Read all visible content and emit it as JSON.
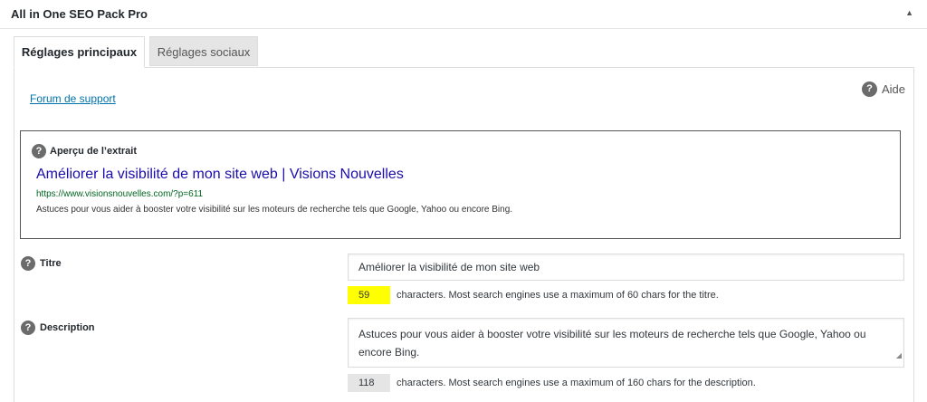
{
  "panel": {
    "title": "All in One SEO Pack Pro",
    "toggle_icon": "triangle-up-icon",
    "toggle_glyph": "▲"
  },
  "tabs": [
    {
      "label": "Réglages principaux",
      "active": true
    },
    {
      "label": "Réglages sociaux",
      "active": false
    }
  ],
  "support_link": "Forum de support",
  "help": {
    "label": "Aide",
    "icon": "question-icon",
    "glyph": "?"
  },
  "snippet": {
    "heading": "Aperçu de l’extrait",
    "title": "Améliorer la visibilité de mon site web | Visions Nouvelles",
    "url": "https://www.visionsnouvelles.com/?p=611",
    "description": "Astuces pour vous aider à booster votre visibilité sur les moteurs de recherche tels que Google, Yahoo ou encore Bing."
  },
  "fields": {
    "title": {
      "label": "Titre",
      "value": "Améliorer la visibilité de mon site web",
      "count": "59",
      "note": "characters. Most search engines use a maximum of 60 chars for the titre."
    },
    "description": {
      "label": "Description",
      "value": "Astuces pour vous aider à booster votre visibilité sur les moteurs de recherche tels que Google, Yahoo ou encore Bing.",
      "count": "118",
      "note": "characters. Most search engines use a maximum of 160 chars for the description."
    }
  },
  "colors": {
    "link": "#0073aa",
    "snippet_title": "#1a0dab",
    "snippet_url": "#006621",
    "counter_highlight": "#ffff00"
  }
}
